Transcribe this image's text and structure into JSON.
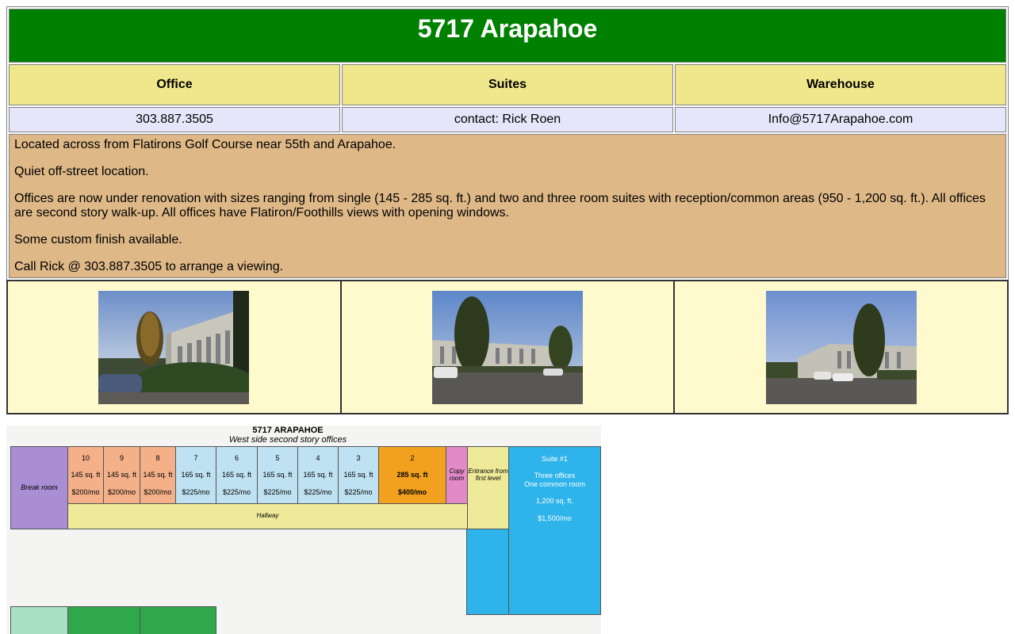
{
  "header": {
    "title": "5717 Arapahoe"
  },
  "columns": [
    "Office",
    "Suites",
    "Warehouse"
  ],
  "contact": {
    "phone": "303.887.3505",
    "person": "contact: Rick Roen",
    "email": "Info@5717Arapahoe.com"
  },
  "description": [
    "Located across from Flatirons Golf Course near 55th and Arapahoe.",
    "Quiet off-street location.",
    "Offices are now under renovation with sizes ranging from single (145 - 285 sq. ft.) and two and three room suites with reception/common areas (950 - 1,200 sq. ft.). All offices are second story walk-up. All offices have Flatiron/Foothills views with opening windows.",
    "Some custom finish available.",
    "Call Rick @ 303.887.3505 to arrange a viewing."
  ],
  "floorplan": {
    "title": "5717 ARAPAHOE",
    "subtitle": "West side second story offices",
    "break_room": "Break room",
    "hallway": "Hallway",
    "copy_room": "Copy room",
    "entrance": "Entrance from first level",
    "offices": [
      {
        "num": "10",
        "size": "145 sq. ft",
        "price": "$200/mo"
      },
      {
        "num": "9",
        "size": "145 sq. ft",
        "price": "$200/mo"
      },
      {
        "num": "8",
        "size": "145 sq. ft",
        "price": "$200/mo"
      },
      {
        "num": "7",
        "size": "165 sq. ft",
        "price": "$225/mo"
      },
      {
        "num": "6",
        "size": "165 sq. ft",
        "price": "$225/mo"
      },
      {
        "num": "5",
        "size": "165 sq. ft",
        "price": "$225/mo"
      },
      {
        "num": "4",
        "size": "165 sq. ft",
        "price": "$225/mo"
      },
      {
        "num": "3",
        "size": "165 sq. ft",
        "price": "$225/mo"
      },
      {
        "num": "2",
        "size": "285 sq. ft",
        "price": "$400/mo"
      }
    ],
    "suite": {
      "name": "Suite #1",
      "desc1": "Three offices",
      "desc2": "One common room",
      "size": "1,200 sq. ft.",
      "price": "$1,500/mo"
    }
  },
  "colors": {
    "title_bg": "#008000",
    "header_bg": "#f0e68c",
    "contact_bg": "#e6e6fa",
    "desc_bg": "#deb887",
    "photo_bg": "#fffacd"
  }
}
